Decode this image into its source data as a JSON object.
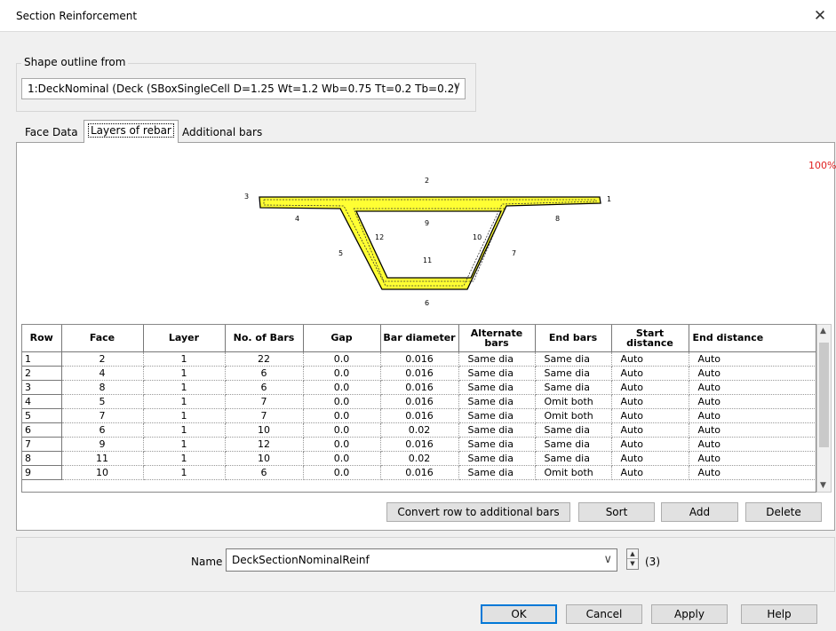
{
  "window": {
    "title": "Section Reinforcement",
    "close": "✕"
  },
  "shape_outline": {
    "label": "Shape outline from",
    "selected": "1:DeckNominal (Deck (SBoxSingleCell D=1.25 Wt=1.2 Wb=0.75 Tt=0.2 Tb=0.2)",
    "chevron": "∨"
  },
  "tabs": [
    "Face Data",
    "Layers of rebar",
    "Additional bars"
  ],
  "preview": {
    "zoom": "100%",
    "face_labels": [
      "1",
      "2",
      "3",
      "4",
      "5",
      "6",
      "7",
      "8",
      "9",
      "10",
      "11",
      "12"
    ],
    "fill_color": "#ffff33",
    "outline_color": "#000000"
  },
  "table": {
    "headers": [
      "Row",
      "Face",
      "Layer",
      "No. of Bars",
      "Gap",
      "Bar diameter",
      "Alternate bars",
      "End bars",
      "Start distance",
      "End distance"
    ],
    "rows": [
      [
        "1",
        "2",
        "1",
        "22",
        "0.0",
        "0.016",
        "Same dia",
        "Same dia",
        "Auto",
        "Auto"
      ],
      [
        "2",
        "4",
        "1",
        "6",
        "0.0",
        "0.016",
        "Same dia",
        "Same dia",
        "Auto",
        "Auto"
      ],
      [
        "3",
        "8",
        "1",
        "6",
        "0.0",
        "0.016",
        "Same dia",
        "Same dia",
        "Auto",
        "Auto"
      ],
      [
        "4",
        "5",
        "1",
        "7",
        "0.0",
        "0.016",
        "Same dia",
        "Omit both",
        "Auto",
        "Auto"
      ],
      [
        "5",
        "7",
        "1",
        "7",
        "0.0",
        "0.016",
        "Same dia",
        "Omit both",
        "Auto",
        "Auto"
      ],
      [
        "6",
        "6",
        "1",
        "10",
        "0.0",
        "0.02",
        "Same dia",
        "Same dia",
        "Auto",
        "Auto"
      ],
      [
        "7",
        "9",
        "1",
        "12",
        "0.0",
        "0.016",
        "Same dia",
        "Same dia",
        "Auto",
        "Auto"
      ],
      [
        "8",
        "11",
        "1",
        "10",
        "0.0",
        "0.02",
        "Same dia",
        "Same dia",
        "Auto",
        "Auto"
      ],
      [
        "9",
        "10",
        "1",
        "6",
        "0.0",
        "0.016",
        "Same dia",
        "Omit both",
        "Auto",
        "Auto"
      ]
    ],
    "scroll_up": "▲",
    "scroll_down": "▼"
  },
  "grid_buttons": {
    "convert": "Convert row to additional bars",
    "sort": "Sort",
    "add": "Add",
    "delete": "Delete"
  },
  "name": {
    "label": "Name",
    "value": "DeckSectionNominalReinf",
    "chevron": "∨",
    "spin_up": "▲",
    "spin_down": "▼",
    "count": "(3)"
  },
  "dialog_buttons": {
    "ok": "OK",
    "cancel": "Cancel",
    "apply": "Apply",
    "help": "Help"
  }
}
